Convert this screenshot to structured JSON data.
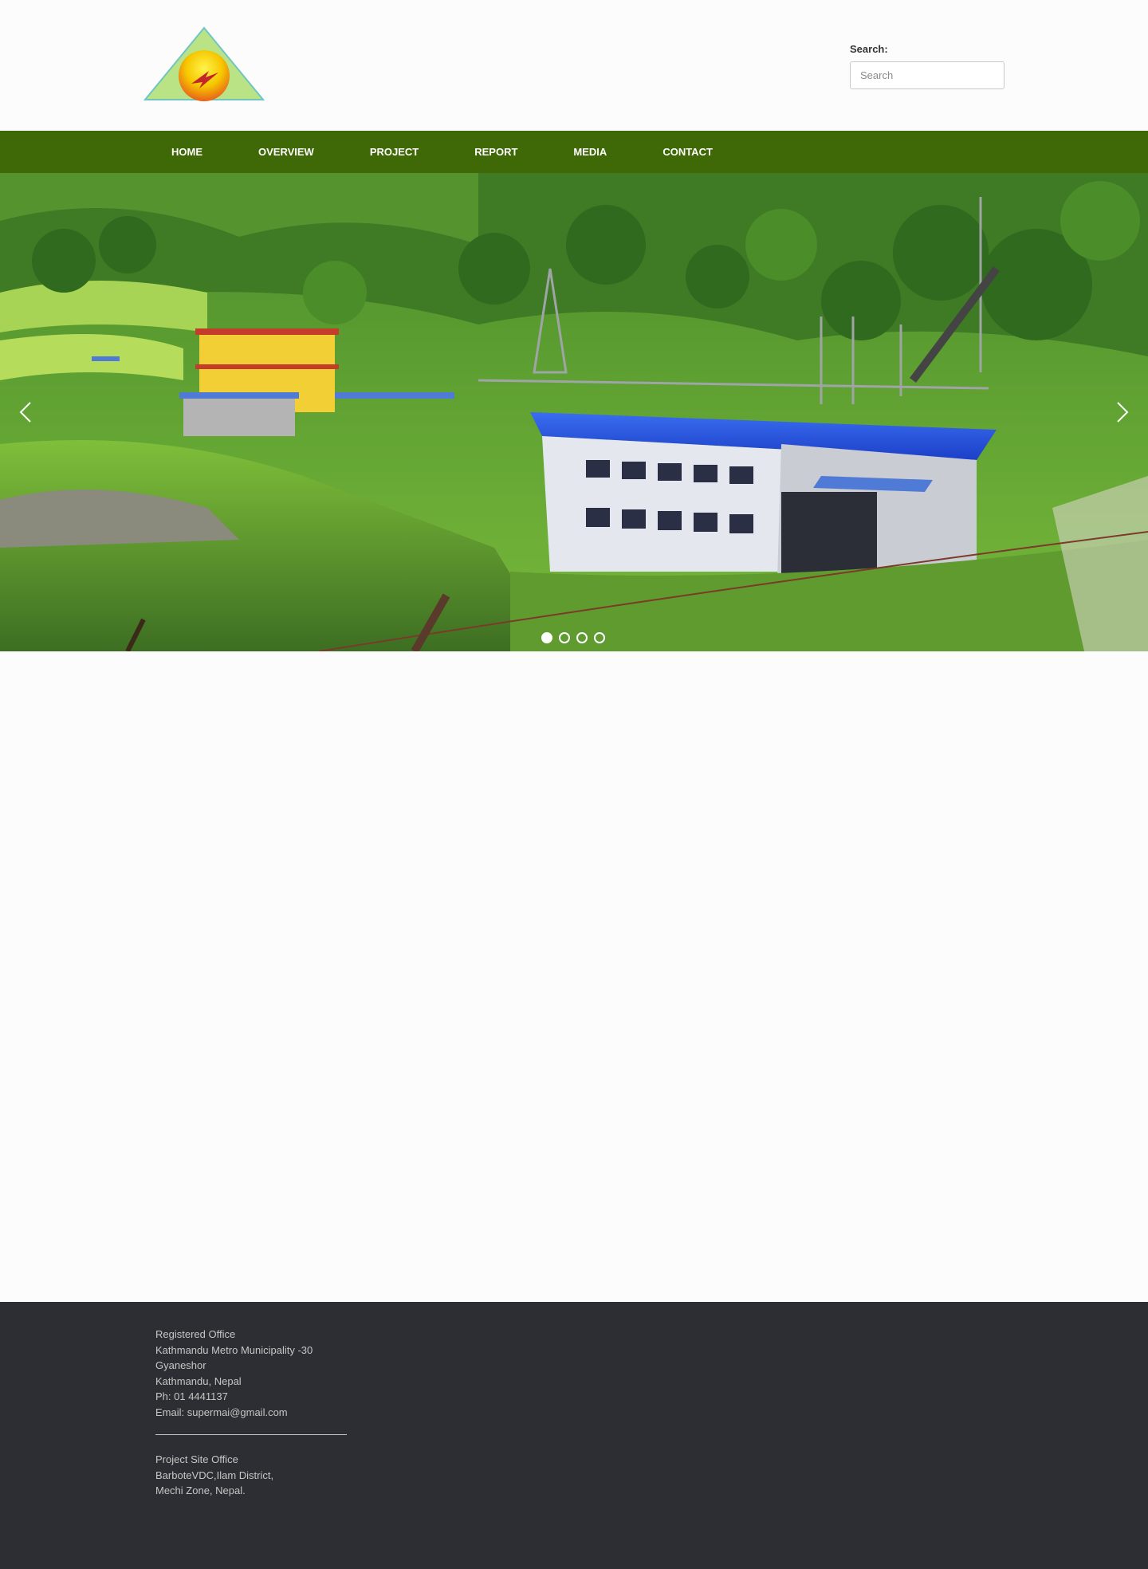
{
  "header": {
    "logo_icon": "bolt-triangle-logo",
    "search": {
      "label": "Search:",
      "placeholder": "Search",
      "value": ""
    }
  },
  "nav": {
    "items": [
      {
        "label": "HOME"
      },
      {
        "label": "OVERVIEW"
      },
      {
        "label": "PROJECT"
      },
      {
        "label": "REPORT"
      },
      {
        "label": "MEDIA"
      },
      {
        "label": "CONTACT"
      }
    ],
    "background_color": "#3f6906"
  },
  "slider": {
    "slide_count": 4,
    "active_index": 0,
    "prev_icon": "chevron-left-icon",
    "next_icon": "chevron-right-icon"
  },
  "footer": {
    "registered_office": {
      "title": "Registered Office",
      "line1": "Kathmandu Metro Municipality -30",
      "line2": "Gyaneshor",
      "line3": "Kathmandu, Nepal",
      "phone": "Ph: 01 4441137",
      "email": "Email: supermai@gmail.com"
    },
    "site_office": {
      "title": "Project Site Office",
      "line1": "BarboteVDC,Ilam District,",
      "line2": "Mechi Zone, Nepal."
    },
    "background_color": "#2d2e33"
  }
}
